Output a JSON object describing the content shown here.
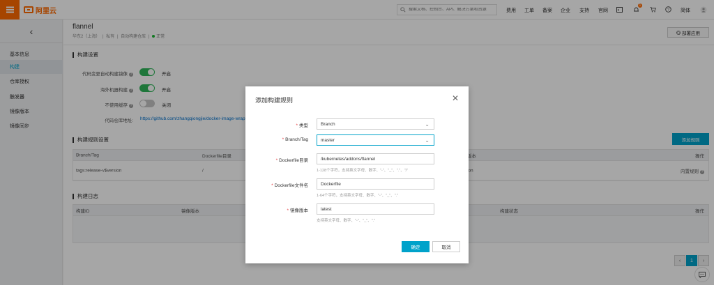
{
  "topbar": {
    "logo_text": "阿里云",
    "search_placeholder": "搜索文档、控制台、API、解决方案和资源",
    "nav": [
      "费用",
      "工单",
      "备案",
      "企业",
      "支持",
      "官网"
    ],
    "lang": "简体",
    "notification_count": "1"
  },
  "sidebar": {
    "items": [
      {
        "label": "基本信息"
      },
      {
        "label": "构建",
        "active": true
      },
      {
        "label": "仓库授权"
      },
      {
        "label": "触发器"
      },
      {
        "label": "镜像版本"
      },
      {
        "label": "镜像同步"
      }
    ]
  },
  "header": {
    "title": "flannel",
    "region": "华东2（上海）",
    "visibility": "私有",
    "repo_type": "自动构建仓库",
    "status": "正常",
    "deploy_label": "部署应用"
  },
  "build_settings": {
    "title": "构建设置",
    "rows": [
      {
        "label": "代码变更自动构建镜像",
        "state": "on",
        "value": "开启"
      },
      {
        "label": "海外机器构建",
        "state": "on",
        "value": "开启"
      },
      {
        "label": "不使用缓存",
        "state": "off",
        "value": "关闭"
      }
    ],
    "repo_label": "代码仓库地址:",
    "repo_url": "https://github.com/zhangqiongjie/docker-image-wrapp"
  },
  "rules": {
    "title": "构建规则设置",
    "add_label": "添加规则",
    "columns": [
      "Branch/Tag",
      "Dockerfile目录",
      "版本",
      "操作"
    ],
    "rows": [
      {
        "branch": "tags:release-v$version",
        "dir": "/",
        "version": "ion",
        "action": "内置规则"
      }
    ]
  },
  "logs": {
    "title": "构建日志",
    "columns": [
      "构建ID",
      "镜像版本",
      "构建状态",
      "操作"
    ]
  },
  "pager": {
    "current": "1"
  },
  "modal": {
    "title": "添加构建规则",
    "fields": {
      "type": {
        "label": "类型",
        "value": "Branch"
      },
      "branch": {
        "label": "Branch/Tag",
        "value": "master"
      },
      "dir": {
        "label": "Dockerfile目录",
        "value": "/kubernetes/addons/flannel",
        "hint": "1-128个字符，支持英文字母、数字、\"-\"、\"_\"、\".\"、\"/\""
      },
      "file": {
        "label": "Dockerfile文件名",
        "value": "Dockerfile",
        "hint": "1-64个字符，支持英文字母、数字、\"-\"、\"_\"、\".\""
      },
      "version": {
        "label": "镜像版本",
        "value": "latest",
        "hint": "支持英文字母、数字、\"-\"、\"_\"、\".\""
      }
    },
    "ok_label": "确定",
    "cancel_label": "取消"
  }
}
